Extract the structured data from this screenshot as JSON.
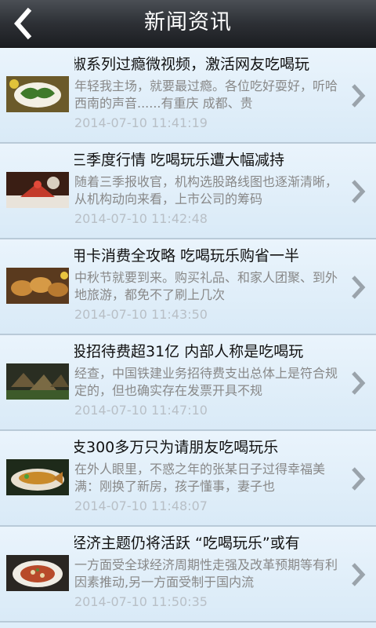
{
  "header": {
    "title": "新闻资讯",
    "back_icon": "back-arrow-icon"
  },
  "news": [
    {
      "title": "椒系列过瘾微视频，激活网友吃喝玩",
      "summary": "年轻我主场，就要最过瘾。各位吃好耍好，听哈西南的声音......有重庆 成都、贵",
      "date": "2014-07-10 11:41:19",
      "thumb": "food-dish-image"
    },
    {
      "title": "三季度行情 吃喝玩乐遭大幅减持",
      "summary": "随着三季报收官，机构选股路线图也逐渐清晰，从机构动向来看，上市公司的筹码",
      "date": "2014-07-10 11:42:48",
      "thumb": "cake-image"
    },
    {
      "title": "用卡消费全攻略 吃喝玩乐购省一半",
      "summary": "中秋节就要到来。购买礼品、和家人团聚、到外地旅游，都免不了刷上几次",
      "date": "2014-07-10 11:43:50",
      "thumb": "mooncake-image"
    },
    {
      "title": "股招待费超31亿 内部人称是吃喝玩",
      "summary": "经查，中国铁建业务招待费支出总体上是符合规定的，但也确实存在发票开具不规",
      "date": "2014-07-10 11:47:10",
      "thumb": "zongzi-image"
    },
    {
      "title": "支300多万只为请朋友吃喝玩乐",
      "summary": "在外人眼里，不惑之年的张某日子过得幸福美满：刚换了新房，孩子懂事，妻子也",
      "date": "2014-07-10 11:48:07",
      "thumb": "fish-dish-image"
    },
    {
      "title": "经济主题仍将活跃 “吃喝玩乐”或有",
      "summary": "一方面受全球经济周期性走强及改革预期等有利因素推动,另一方面受制于国内流",
      "date": "2014-07-10 11:50:35",
      "thumb": "rice-bowl-image"
    }
  ],
  "colors": {
    "header_bg": "#2d3035",
    "row_bg": "#e2effa",
    "title_text": "#111111",
    "summary_text": "#888888",
    "date_text": "#b8bfc6"
  }
}
